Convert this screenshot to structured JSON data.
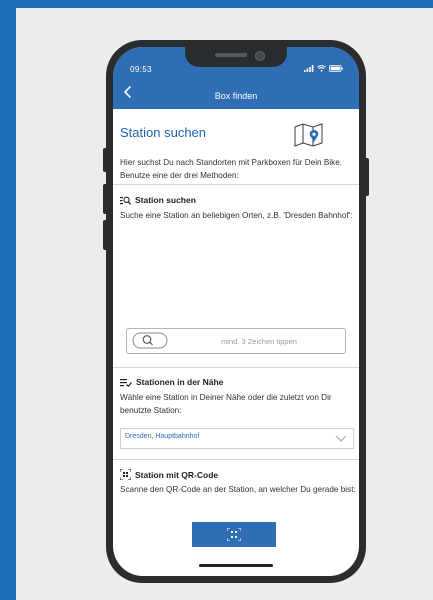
{
  "status_bar": {
    "time": "09:53"
  },
  "header": {
    "title": "Box finden",
    "back_icon": "chevron-left-icon"
  },
  "page": {
    "title": "Station suchen",
    "intro": "Hier suchst Du nach Standorten mit Parkboxen für Dein Bike. Benutze eine der drei Methoden:"
  },
  "sections": {
    "search": {
      "icon": "search-list-icon",
      "title": "Station suchen",
      "text": "Suche eine Station an beliebigen Orten, z.B. 'Dresden Bahnhof':",
      "placeholder": "mind. 3 Zeichen tippen"
    },
    "nearby": {
      "icon": "list-check-icon",
      "title": "Stationen in der Nähe",
      "text": "Wähle eine Station in Deiner Nähe oder die zuletzt von Dir benutzte Station:",
      "selected": "Dresden, Hauptbahnhof"
    },
    "qr": {
      "icon": "qr-code-icon",
      "title": "Station mit QR-Code",
      "text": "Scanne den QR-Code an der Station, an welcher Du gerade bist:"
    }
  },
  "colors": {
    "accent": "#2f6db5",
    "title": "#1f63ad",
    "frame": "#1e6fb9"
  }
}
